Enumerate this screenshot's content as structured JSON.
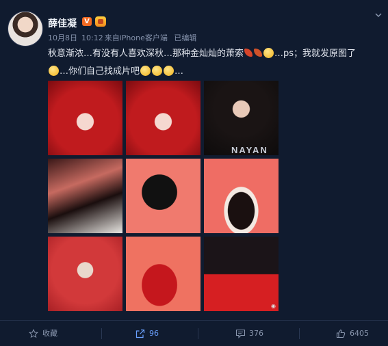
{
  "post": {
    "author": "薛佳凝",
    "verified_badge": "V",
    "meta": {
      "date": "10月8日",
      "time": "10:12",
      "source": "来自iPhone客户端",
      "edited": "已编辑"
    },
    "text_line1": "秋意渐浓…有没有人喜欢深秋…那种金灿灿的萧索",
    "text_line1_end": "…ps；我就发原图了",
    "text_line2": "…你们自己找成片吧",
    "text_line2_end": "…",
    "photo_watermark": "NAYAN"
  },
  "actions": {
    "favorite_label": "收藏",
    "repost_count": "96",
    "comment_count": "376",
    "like_count": "6405"
  },
  "colors": {
    "background": "#101b2f",
    "accent_blue": "#6aa0ff",
    "badge_orange": "#f26a22"
  }
}
